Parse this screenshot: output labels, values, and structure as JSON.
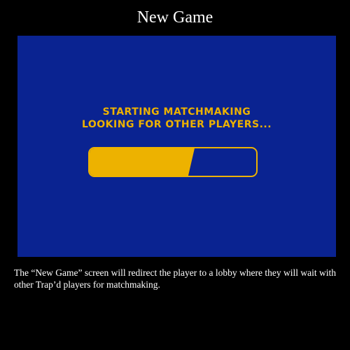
{
  "header": {
    "title": "New Game"
  },
  "screen": {
    "status_line_1": "Starting Matchmaking",
    "status_line_2": "Looking for other players...",
    "progress_fraction": 0.63
  },
  "caption": {
    "text": "The “New Game” screen will redirect the player to a lobby where they will wait with other Trap’d  players for matchmaking."
  },
  "colors": {
    "background": "#000000",
    "screen_blue": "#0a2391",
    "accent_yellow": "#edb200"
  }
}
